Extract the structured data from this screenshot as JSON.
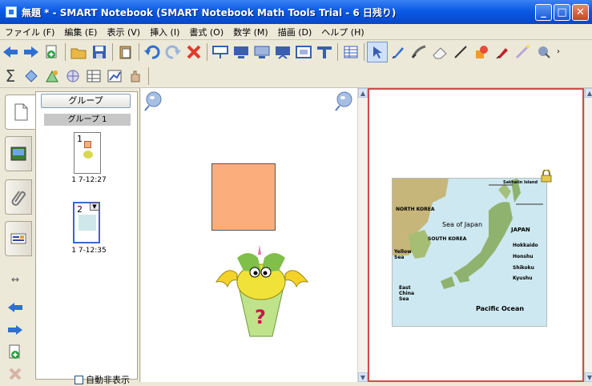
{
  "window": {
    "title": "無題 * - SMART Notebook (SMART Notebook Math Tools Trial - 6 日残り)",
    "controls": {
      "minimize": "_",
      "maximize": "□",
      "close": "✕"
    }
  },
  "menu": {
    "items": [
      "ファイル (F)",
      "編集 (E)",
      "表示 (V)",
      "挿入 (I)",
      "書式 (O)",
      "数学 (M)",
      "描画 (D)",
      "ヘルプ (H)"
    ]
  },
  "toolbar1": {
    "buttons": [
      "back-arrow-icon",
      "forward-arrow-icon",
      "add-page-icon",
      "open-folder-icon",
      "save-icon",
      "paste-icon",
      "undo-icon",
      "redo-icon",
      "delete-icon",
      "screen-shade-icon",
      "display-icon",
      "dual-display-icon",
      "presentation-icon",
      "capture-icon",
      "text-icon",
      "table-icon",
      "select-arrow-icon",
      "pen-icon",
      "creative-pen-icon",
      "eraser-icon",
      "line-icon",
      "shapes-icon",
      "fill-icon",
      "magic-pen-icon",
      "properties-icon"
    ]
  },
  "toolbar2": {
    "math_symbol": "Σ",
    "buttons": [
      "math-shapes-icon",
      "geometry-icon",
      "graph-icon",
      "table-tools-icon",
      "chart-icon",
      "hand-icon"
    ]
  },
  "sidebar": {
    "group_button": "グループ",
    "group_label": "グループ 1",
    "pages": [
      {
        "number": "1",
        "time": "1 7-12:27"
      },
      {
        "number": "2",
        "time": "1 7-12:35"
      }
    ],
    "autohide_label": "自動非表示",
    "tabs": [
      "page-sorter-icon",
      "gallery-icon",
      "attachments-icon",
      "properties-icon"
    ]
  },
  "map": {
    "labels": {
      "north_korea": "NORTH KOREA",
      "sea_of_japan": "Sea of Japan",
      "south_korea": "SOUTH KOREA",
      "yellow_sea": "Yellow Sea",
      "east_china_sea": "East China Sea",
      "pacific_ocean": "Pacific Ocean",
      "japan": "JAPAN",
      "sakhalin": "Sakhalin Island",
      "hokkaido": "Hokkaido",
      "honshu": "Honshu",
      "shikoku": "Shikoku",
      "kyushu": "Kyushu"
    }
  },
  "colors": {
    "title_bar": "#0a5ae6",
    "orange_square": "#fbae7b",
    "page_border": "#d34a4a"
  }
}
